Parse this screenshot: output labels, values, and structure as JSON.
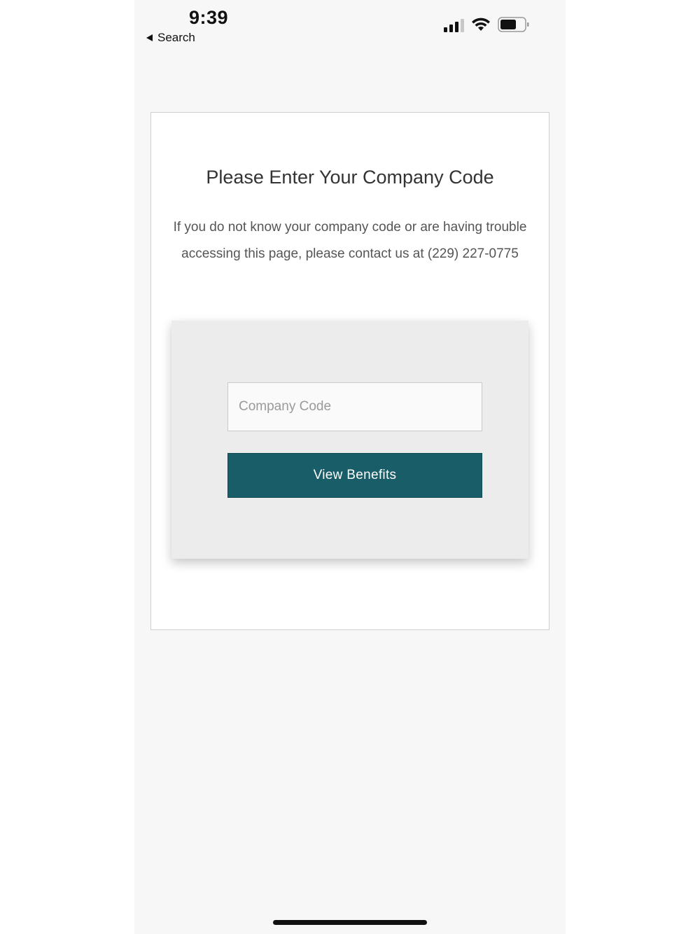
{
  "status_bar": {
    "time": "9:39",
    "back_label": "Search",
    "icons": [
      "cellular-signal-icon",
      "wifi-icon",
      "battery-icon"
    ]
  },
  "page": {
    "title": "Please Enter Your Company Code",
    "description": "If you do not know your company code or are having trouble accessing this page, please contact us at (229) 227-0775"
  },
  "form": {
    "code_placeholder": "Company Code",
    "code_value": "",
    "submit_label": "View Benefits"
  },
  "colors": {
    "button_bg": "#185d67",
    "panel_bg": "#ececec",
    "screen_bg": "#f7f7f7"
  }
}
